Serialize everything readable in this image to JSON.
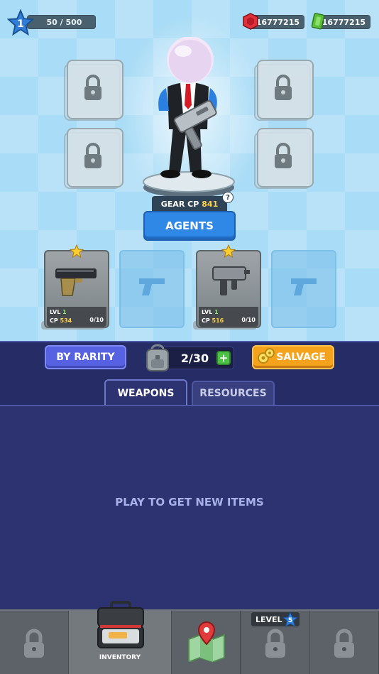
{
  "hud": {
    "player_level": "1",
    "xp_text": "50 / 500",
    "gems": "16777215",
    "cash": "16777215"
  },
  "agent": {
    "gear_cp_label": "GEAR CP",
    "gear_cp_value": "841",
    "help_label": "?",
    "agents_button": "AGENTS"
  },
  "weapons": [
    {
      "lvl_label": "LVL",
      "lvl": "1",
      "cp_label": "CP",
      "cp": "534",
      "progress": "0/10"
    },
    {
      "lvl_label": "LVL",
      "lvl": "1",
      "cp_label": "CP",
      "cp": "516",
      "progress": "0/10"
    }
  ],
  "toolbar": {
    "rarity_button": "BY RARITY",
    "bag_count": "2/30",
    "plus_label": "+",
    "salvage_button": "SALVAGE"
  },
  "tabs": {
    "weapons": "WEAPONS",
    "resources": "RESOURCES"
  },
  "inventory": {
    "empty_message": "PLAY TO GET NEW ITEMS"
  },
  "nav": {
    "inventory_label": "INVENTORY",
    "level_label": "LEVEL",
    "level_req": "5"
  },
  "colors": {
    "accent_blue": "#2f87e6",
    "salvage_orange": "#f5a21d",
    "panel": "#2d3370",
    "cp_yellow": "#ffd14a",
    "lvl_green": "#8fe27a"
  }
}
